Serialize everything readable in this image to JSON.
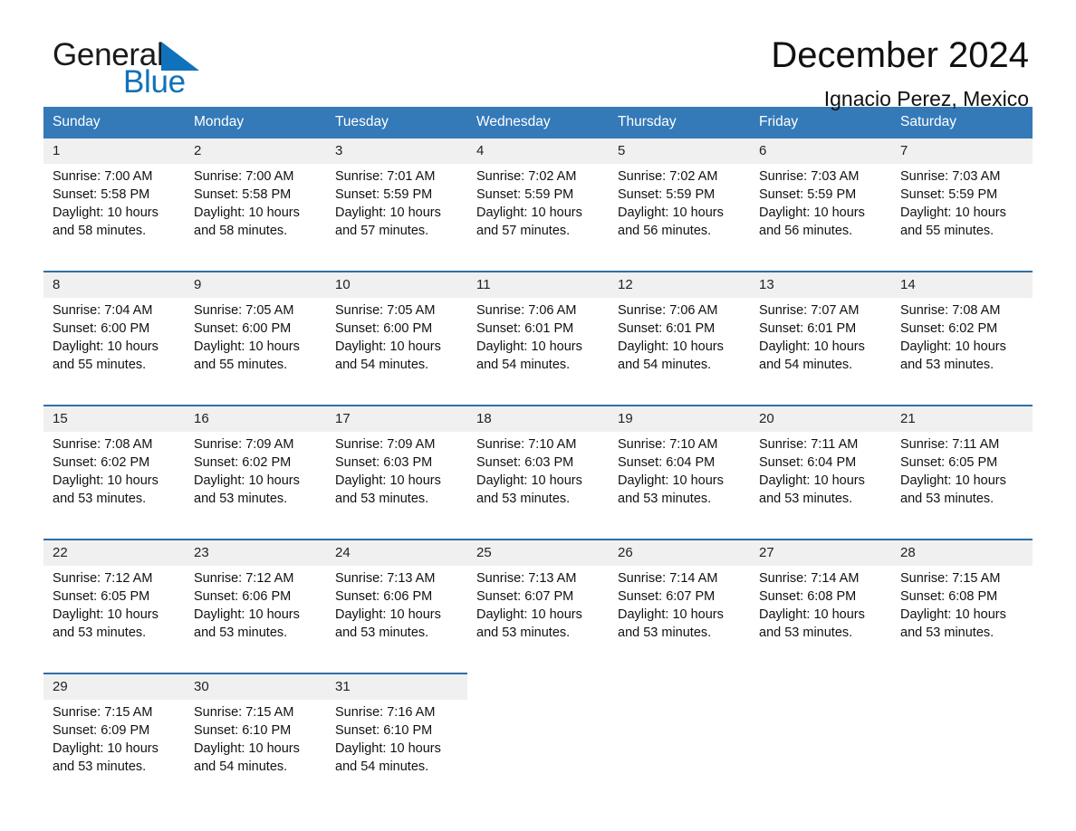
{
  "brand": {
    "name_part1": "General",
    "name_part2": "Blue",
    "logo_icon": "triangle-logo-icon"
  },
  "header": {
    "month_title": "December 2024",
    "location": "Ignacio Perez, Mexico"
  },
  "colors": {
    "header_blue": "#3479b8",
    "brand_blue": "#1072ba",
    "daynum_bg": "#f0f0f0",
    "row_divider": "#2f6fa8"
  },
  "calendar": {
    "weekday_headers": [
      "Sunday",
      "Monday",
      "Tuesday",
      "Wednesday",
      "Thursday",
      "Friday",
      "Saturday"
    ],
    "weeks": [
      [
        {
          "day": "1",
          "sunrise": "Sunrise: 7:00 AM",
          "sunset": "Sunset: 5:58 PM",
          "daylight": "Daylight: 10 hours and 58 minutes."
        },
        {
          "day": "2",
          "sunrise": "Sunrise: 7:00 AM",
          "sunset": "Sunset: 5:58 PM",
          "daylight": "Daylight: 10 hours and 58 minutes."
        },
        {
          "day": "3",
          "sunrise": "Sunrise: 7:01 AM",
          "sunset": "Sunset: 5:59 PM",
          "daylight": "Daylight: 10 hours and 57 minutes."
        },
        {
          "day": "4",
          "sunrise": "Sunrise: 7:02 AM",
          "sunset": "Sunset: 5:59 PM",
          "daylight": "Daylight: 10 hours and 57 minutes."
        },
        {
          "day": "5",
          "sunrise": "Sunrise: 7:02 AM",
          "sunset": "Sunset: 5:59 PM",
          "daylight": "Daylight: 10 hours and 56 minutes."
        },
        {
          "day": "6",
          "sunrise": "Sunrise: 7:03 AM",
          "sunset": "Sunset: 5:59 PM",
          "daylight": "Daylight: 10 hours and 56 minutes."
        },
        {
          "day": "7",
          "sunrise": "Sunrise: 7:03 AM",
          "sunset": "Sunset: 5:59 PM",
          "daylight": "Daylight: 10 hours and 55 minutes."
        }
      ],
      [
        {
          "day": "8",
          "sunrise": "Sunrise: 7:04 AM",
          "sunset": "Sunset: 6:00 PM",
          "daylight": "Daylight: 10 hours and 55 minutes."
        },
        {
          "day": "9",
          "sunrise": "Sunrise: 7:05 AM",
          "sunset": "Sunset: 6:00 PM",
          "daylight": "Daylight: 10 hours and 55 minutes."
        },
        {
          "day": "10",
          "sunrise": "Sunrise: 7:05 AM",
          "sunset": "Sunset: 6:00 PM",
          "daylight": "Daylight: 10 hours and 54 minutes."
        },
        {
          "day": "11",
          "sunrise": "Sunrise: 7:06 AM",
          "sunset": "Sunset: 6:01 PM",
          "daylight": "Daylight: 10 hours and 54 minutes."
        },
        {
          "day": "12",
          "sunrise": "Sunrise: 7:06 AM",
          "sunset": "Sunset: 6:01 PM",
          "daylight": "Daylight: 10 hours and 54 minutes."
        },
        {
          "day": "13",
          "sunrise": "Sunrise: 7:07 AM",
          "sunset": "Sunset: 6:01 PM",
          "daylight": "Daylight: 10 hours and 54 minutes."
        },
        {
          "day": "14",
          "sunrise": "Sunrise: 7:08 AM",
          "sunset": "Sunset: 6:02 PM",
          "daylight": "Daylight: 10 hours and 53 minutes."
        }
      ],
      [
        {
          "day": "15",
          "sunrise": "Sunrise: 7:08 AM",
          "sunset": "Sunset: 6:02 PM",
          "daylight": "Daylight: 10 hours and 53 minutes."
        },
        {
          "day": "16",
          "sunrise": "Sunrise: 7:09 AM",
          "sunset": "Sunset: 6:02 PM",
          "daylight": "Daylight: 10 hours and 53 minutes."
        },
        {
          "day": "17",
          "sunrise": "Sunrise: 7:09 AM",
          "sunset": "Sunset: 6:03 PM",
          "daylight": "Daylight: 10 hours and 53 minutes."
        },
        {
          "day": "18",
          "sunrise": "Sunrise: 7:10 AM",
          "sunset": "Sunset: 6:03 PM",
          "daylight": "Daylight: 10 hours and 53 minutes."
        },
        {
          "day": "19",
          "sunrise": "Sunrise: 7:10 AM",
          "sunset": "Sunset: 6:04 PM",
          "daylight": "Daylight: 10 hours and 53 minutes."
        },
        {
          "day": "20",
          "sunrise": "Sunrise: 7:11 AM",
          "sunset": "Sunset: 6:04 PM",
          "daylight": "Daylight: 10 hours and 53 minutes."
        },
        {
          "day": "21",
          "sunrise": "Sunrise: 7:11 AM",
          "sunset": "Sunset: 6:05 PM",
          "daylight": "Daylight: 10 hours and 53 minutes."
        }
      ],
      [
        {
          "day": "22",
          "sunrise": "Sunrise: 7:12 AM",
          "sunset": "Sunset: 6:05 PM",
          "daylight": "Daylight: 10 hours and 53 minutes."
        },
        {
          "day": "23",
          "sunrise": "Sunrise: 7:12 AM",
          "sunset": "Sunset: 6:06 PM",
          "daylight": "Daylight: 10 hours and 53 minutes."
        },
        {
          "day": "24",
          "sunrise": "Sunrise: 7:13 AM",
          "sunset": "Sunset: 6:06 PM",
          "daylight": "Daylight: 10 hours and 53 minutes."
        },
        {
          "day": "25",
          "sunrise": "Sunrise: 7:13 AM",
          "sunset": "Sunset: 6:07 PM",
          "daylight": "Daylight: 10 hours and 53 minutes."
        },
        {
          "day": "26",
          "sunrise": "Sunrise: 7:14 AM",
          "sunset": "Sunset: 6:07 PM",
          "daylight": "Daylight: 10 hours and 53 minutes."
        },
        {
          "day": "27",
          "sunrise": "Sunrise: 7:14 AM",
          "sunset": "Sunset: 6:08 PM",
          "daylight": "Daylight: 10 hours and 53 minutes."
        },
        {
          "day": "28",
          "sunrise": "Sunrise: 7:15 AM",
          "sunset": "Sunset: 6:08 PM",
          "daylight": "Daylight: 10 hours and 53 minutes."
        }
      ],
      [
        {
          "day": "29",
          "sunrise": "Sunrise: 7:15 AM",
          "sunset": "Sunset: 6:09 PM",
          "daylight": "Daylight: 10 hours and 53 minutes."
        },
        {
          "day": "30",
          "sunrise": "Sunrise: 7:15 AM",
          "sunset": "Sunset: 6:10 PM",
          "daylight": "Daylight: 10 hours and 54 minutes."
        },
        {
          "day": "31",
          "sunrise": "Sunrise: 7:16 AM",
          "sunset": "Sunset: 6:10 PM",
          "daylight": "Daylight: 10 hours and 54 minutes."
        },
        {
          "day": "",
          "sunrise": "",
          "sunset": "",
          "daylight": ""
        },
        {
          "day": "",
          "sunrise": "",
          "sunset": "",
          "daylight": ""
        },
        {
          "day": "",
          "sunrise": "",
          "sunset": "",
          "daylight": ""
        },
        {
          "day": "",
          "sunrise": "",
          "sunset": "",
          "daylight": ""
        }
      ]
    ]
  }
}
